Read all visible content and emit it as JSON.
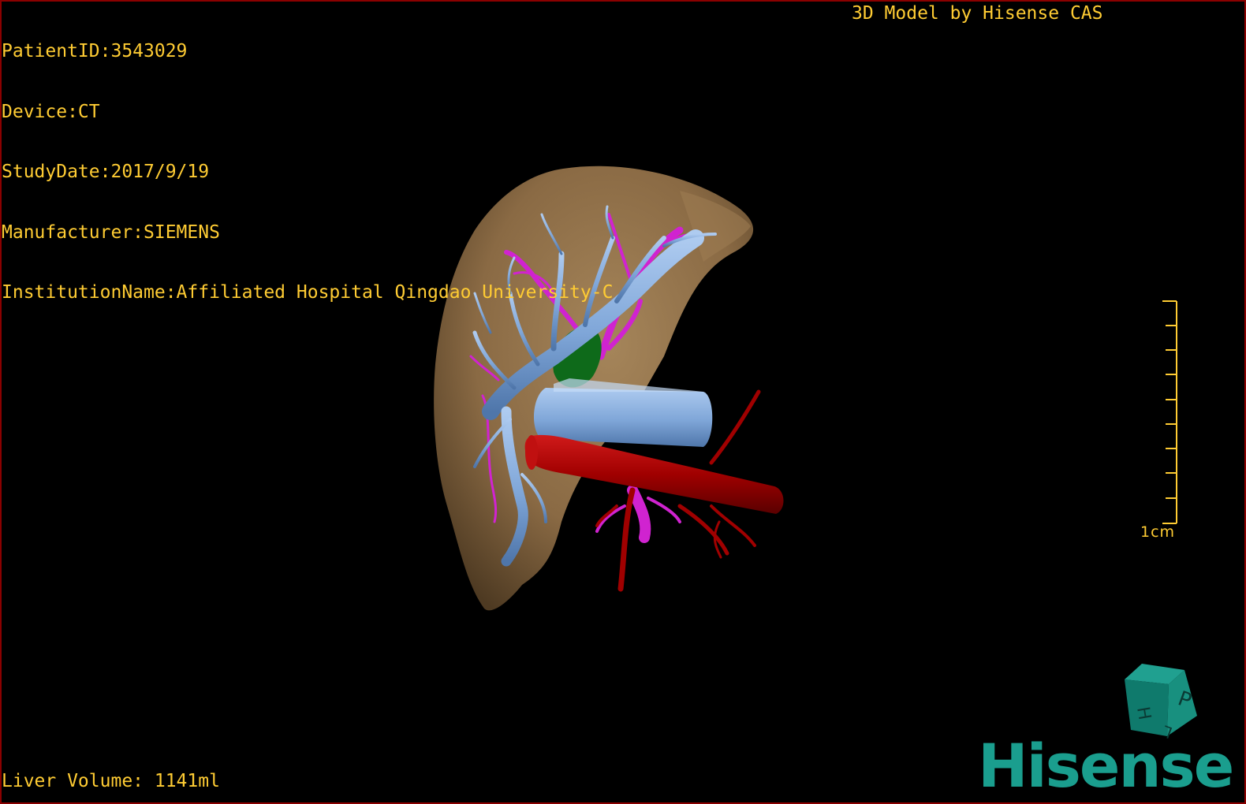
{
  "overlay": {
    "patient_id": "PatientID:3543029",
    "device": "Device:CT",
    "study_date": "StudyDate:2017/9/19",
    "manufacturer": "Manufacturer:SIEMENS",
    "institution": "InstitutionName:Affiliated Hospital Qingdao University-C",
    "credit": "3D Model by Hisense CAS",
    "liver_volume": "Liver Volume: 1141ml"
  },
  "scale": {
    "label": "1cm"
  },
  "orientation_cube": {
    "faces": [
      "P",
      "H",
      "L"
    ]
  },
  "brand": {
    "logo_text": "Hisense"
  },
  "colors": {
    "overlay_text": "#ffcc33",
    "frame_border": "#8b0000",
    "liver": "#8a6a44",
    "portal_vein": "#7fa6d8",
    "hepatic_artery_branch": "#d023d0",
    "aorta": "#a00000",
    "gallbladder": "#0e6a1a",
    "brand": "#1a9e8e"
  }
}
